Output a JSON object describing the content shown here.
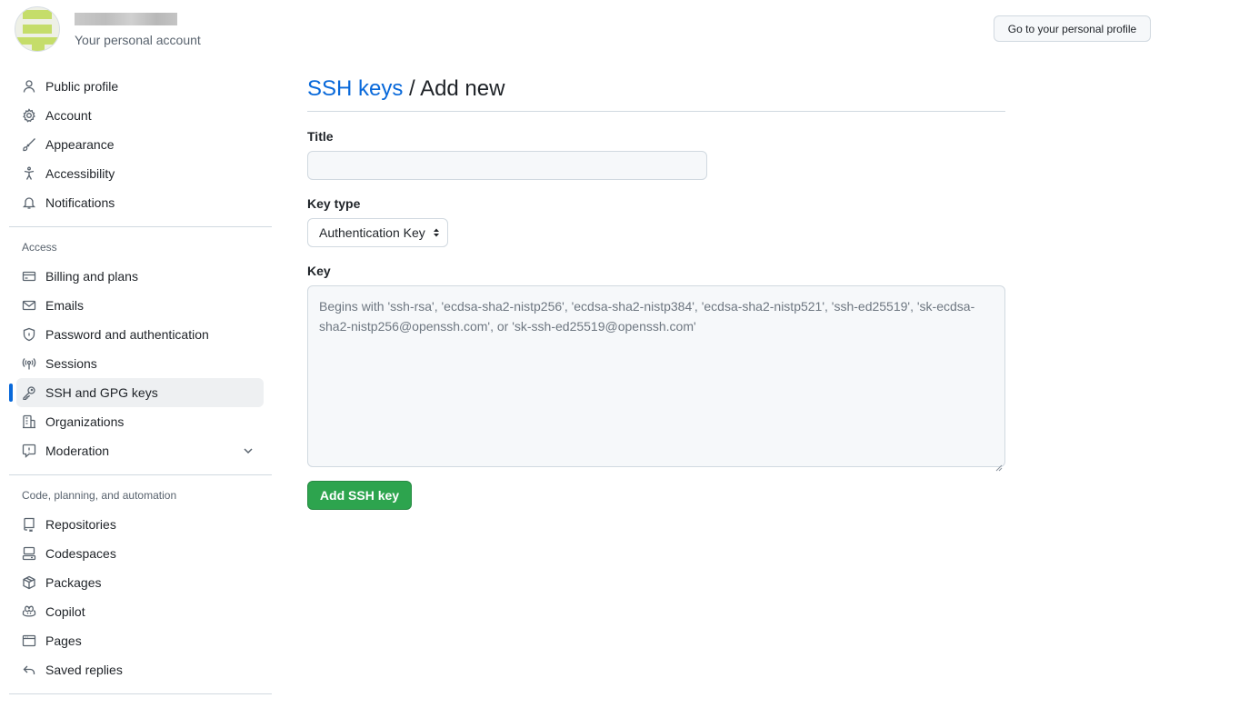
{
  "header": {
    "account_subtitle": "Your personal account",
    "profile_button": "Go to your personal profile"
  },
  "sidebar": {
    "top_items": [
      {
        "label": "Public profile",
        "icon": "person-icon"
      },
      {
        "label": "Account",
        "icon": "gear-icon"
      },
      {
        "label": "Appearance",
        "icon": "paintbrush-icon"
      },
      {
        "label": "Accessibility",
        "icon": "accessibility-icon"
      },
      {
        "label": "Notifications",
        "icon": "bell-icon"
      }
    ],
    "access_heading": "Access",
    "access_items": [
      {
        "label": "Billing and plans",
        "icon": "credit-card-icon"
      },
      {
        "label": "Emails",
        "icon": "mail-icon"
      },
      {
        "label": "Password and authentication",
        "icon": "shield-lock-icon"
      },
      {
        "label": "Sessions",
        "icon": "broadcast-icon"
      },
      {
        "label": "SSH and GPG keys",
        "icon": "key-icon",
        "active": true
      },
      {
        "label": "Organizations",
        "icon": "organization-icon"
      },
      {
        "label": "Moderation",
        "icon": "report-icon",
        "expandable": true
      }
    ],
    "code_heading": "Code, planning, and automation",
    "code_items": [
      {
        "label": "Repositories",
        "icon": "repo-icon"
      },
      {
        "label": "Codespaces",
        "icon": "codespaces-icon"
      },
      {
        "label": "Packages",
        "icon": "package-icon"
      },
      {
        "label": "Copilot",
        "icon": "copilot-icon"
      },
      {
        "label": "Pages",
        "icon": "browser-icon"
      },
      {
        "label": "Saved replies",
        "icon": "reply-icon"
      }
    ]
  },
  "main": {
    "breadcrumb_link": "SSH keys",
    "breadcrumb_separator": " / ",
    "breadcrumb_current": "Add new",
    "title_label": "Title",
    "title_value": "",
    "key_type_label": "Key type",
    "key_type_selected": "Authentication Key",
    "key_label": "Key",
    "key_placeholder": "Begins with 'ssh-rsa', 'ecdsa-sha2-nistp256', 'ecdsa-sha2-nistp384', 'ecdsa-sha2-nistp521', 'ssh-ed25519', 'sk-ecdsa-sha2-nistp256@openssh.com', or 'sk-ssh-ed25519@openssh.com'",
    "submit_label": "Add SSH key"
  },
  "colors": {
    "link": "#0969da",
    "primary_button": "#2da44e",
    "active_indicator": "#0969da",
    "avatar_accent": "#c5dd6a"
  }
}
